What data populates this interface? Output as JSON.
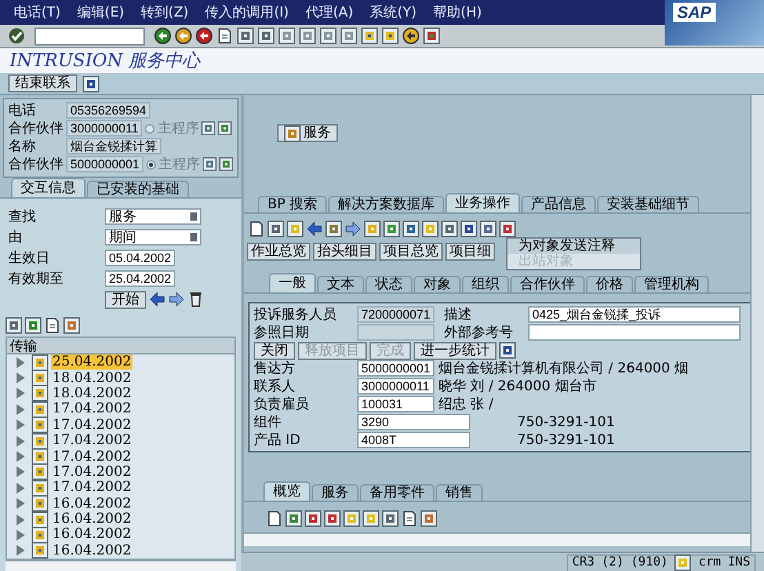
{
  "menu": [
    "电话(T)",
    "编辑(E)",
    "转到(Z)",
    "传入的调用(I)",
    "代理(A)",
    "系统(Y)",
    "帮助(H)"
  ],
  "logo": "SAP",
  "title": "INTRUSION 服务中心",
  "app_button": "结束联系",
  "contact": [
    {
      "kind": "text",
      "label": "电话",
      "value": "05356269594"
    },
    {
      "kind": "partner",
      "label": "合作伙伴",
      "value": "3000000011",
      "main_label": "主程序",
      "selected": false
    },
    {
      "kind": "text",
      "label": "名称",
      "value": "烟台金锐揉计算"
    },
    {
      "kind": "partner",
      "label": "合作伙伴",
      "value": "5000000001",
      "main_label": "主程序",
      "selected": true
    }
  ],
  "service_button": "服务",
  "left_tabs": [
    {
      "label": "交互信息",
      "selected": true
    },
    {
      "label": "已安装的基础",
      "selected": false
    }
  ],
  "search": [
    {
      "kind": "dropdown",
      "label": "查找",
      "value": "服务"
    },
    {
      "kind": "dropdown",
      "label": "由",
      "value": "期间"
    },
    {
      "kind": "date",
      "label": "生效日",
      "value": "05.04.2002"
    },
    {
      "kind": "date",
      "label": "有效期至",
      "value": "25.04.2002"
    }
  ],
  "start_button": "开始",
  "tree": {
    "header": "传输",
    "items": [
      {
        "label": "25.04.2002",
        "selected": true
      },
      {
        "label": "18.04.2002",
        "selected": false
      },
      {
        "label": "18.04.2002",
        "selected": false
      },
      {
        "label": "17.04.2002",
        "selected": false
      },
      {
        "label": "17.04.2002",
        "selected": false
      },
      {
        "label": "17.04.2002",
        "selected": false
      },
      {
        "label": "17.04.2002",
        "selected": false
      },
      {
        "label": "17.04.2002",
        "selected": false
      },
      {
        "label": "17.04.2002",
        "selected": false
      },
      {
        "label": "16.04.2002",
        "selected": false
      },
      {
        "label": "16.04.2002",
        "selected": false
      },
      {
        "label": "16.04.2002",
        "selected": false
      },
      {
        "label": "16.04.2002",
        "selected": false
      }
    ]
  },
  "right_tabs": [
    {
      "label": "BP 搜索",
      "selected": false
    },
    {
      "label": "解决方案数据库",
      "selected": false
    },
    {
      "label": "业务操作",
      "selected": true
    },
    {
      "label": "产品信息",
      "selected": false
    },
    {
      "label": "安装基础细节",
      "selected": false
    }
  ],
  "popup_menu": [
    {
      "label": "为对象发送注释",
      "disabled": false
    },
    {
      "label": "出站对象",
      "disabled": true
    }
  ],
  "view_buttons": [
    "作业总览",
    "抬头细目",
    "项目总览",
    "项目细"
  ],
  "detail_tabs": [
    {
      "label": "一般",
      "selected": true
    },
    {
      "label": "文本",
      "selected": false
    },
    {
      "label": "状态",
      "selected": false
    },
    {
      "label": "对象",
      "selected": false
    },
    {
      "label": "组织",
      "selected": false
    },
    {
      "label": "合作伙伴",
      "selected": false
    },
    {
      "label": "价格",
      "selected": false
    },
    {
      "label": "管理机构",
      "selected": false
    }
  ],
  "header_fields": [
    {
      "label": "投诉服务人员",
      "value": "7200000071",
      "label2": "描述",
      "value2": "0425_烟台金锐揉_投诉"
    },
    {
      "label": "参照日期",
      "label2": "外部参考号"
    }
  ],
  "actions": [
    {
      "label": "关闭",
      "disabled": false
    },
    {
      "label": "释放项目",
      "disabled": true
    },
    {
      "label": "完成",
      "disabled": true
    },
    {
      "label": "进一步统计",
      "disabled": false
    }
  ],
  "parties": [
    {
      "kind": "partner",
      "label": "售达方",
      "id": "5000000001",
      "text": "烟台金锐揉计算机有限公司 / 264000 烟"
    },
    {
      "kind": "partner",
      "label": "联系人",
      "id": "3000000011",
      "text": "晓华 刘 / 264000 烟台市"
    },
    {
      "kind": "partner",
      "label": "负责雇员",
      "id": "100031",
      "text": "绍忠 张 /"
    },
    {
      "kind": "item",
      "label": "组件",
      "id": "3290",
      "text": "750-3291-101"
    },
    {
      "kind": "item",
      "label": "产品 ID",
      "id": "4008T",
      "text": "750-3291-101"
    }
  ],
  "bottom_tabs": [
    {
      "label": "概览",
      "selected": true
    },
    {
      "label": "服务",
      "selected": false
    },
    {
      "label": "备用零件",
      "selected": false
    },
    {
      "label": "销售",
      "selected": false
    }
  ],
  "status_bar": {
    "system": "CR3",
    "session": "(2)",
    "client": "(910)",
    "server": "crm",
    "mode": "INS"
  }
}
